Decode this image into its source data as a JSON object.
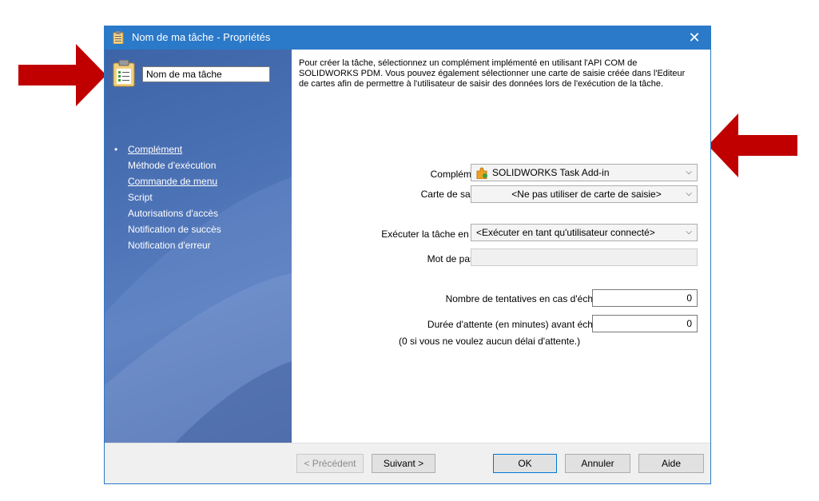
{
  "window": {
    "title": "Nom de ma tâche - Propriétés",
    "close_symbol": "✕"
  },
  "sidebar": {
    "task_name_value": "Nom de ma tâche",
    "bullet": "•",
    "items": [
      {
        "label": "Complément",
        "link": true
      },
      {
        "label": "Méthode d'exécution",
        "link": false
      },
      {
        "label": "Commande de menu",
        "link": true
      },
      {
        "label": "Script",
        "link": false
      },
      {
        "label": "Autorisations d'accès",
        "link": false
      },
      {
        "label": "Notification de succès",
        "link": false
      },
      {
        "label": "Notification d'erreur",
        "link": false
      }
    ]
  },
  "content": {
    "description": "Pour créer la tâche, sélectionnez un complément implémenté en utilisant l'API COM de SOLIDWORKS PDM. Vous pouvez également sélectionner une carte de saisie créée dans l'Editeur de cartes afin de permettre à l'utilisateur de saisir des données lors de l'exécution de la tâche.",
    "addin_label": "Complément:",
    "addin_value": "SOLIDWORKS Task Add-in",
    "card_label": "Carte de saisie:",
    "card_value": "<Ne pas utiliser de carte de saisie>",
    "run_as_label": "Exécuter la tâche en tant",
    "run_as_value": "<Exécuter en tant qu'utilisateur connecté>",
    "password_label": "Mot de passe:",
    "retries_label": "Nombre de tentatives en cas d'échec:",
    "retries_value": "0",
    "wait_label": "Durée d'attente (en minutes) avant échec:",
    "wait_value": "0",
    "wait_note": "(0 si vous ne voulez aucun délai d'attente.)"
  },
  "footer": {
    "prev": "< Précédent",
    "next": "Suivant >",
    "ok": "OK",
    "cancel": "Annuler",
    "help": "Aide"
  },
  "colors": {
    "titlebar": "#2b79c9",
    "arrow": "#c00000",
    "sidebar": "#4c72b6"
  },
  "icons": [
    "clipboard-icon",
    "close-icon",
    "addin-puzzle-icon",
    "chevron-down-icon",
    "red-arrow-icon"
  ]
}
